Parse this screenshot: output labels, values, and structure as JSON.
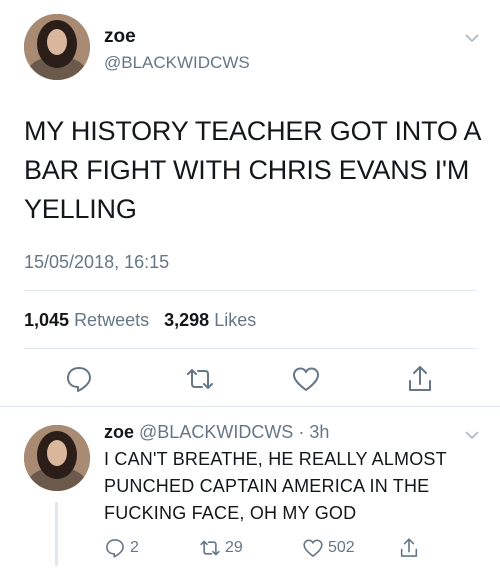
{
  "tweet": {
    "author_name": "zoe",
    "author_handle": "@BLACKWIDCWS",
    "text": "MY HISTORY TEACHER GOT INTO A BAR FIGHT WITH CHRIS EVANS I'M YELLING",
    "timestamp": "15/05/2018, 16:15",
    "retweets_count": "1,045",
    "retweets_label": "Retweets",
    "likes_count": "3,298",
    "likes_label": "Likes",
    "icons": [
      "avatar",
      "chevron-down-icon",
      "reply-icon",
      "retweet-icon",
      "like-icon",
      "share-icon"
    ]
  },
  "reply": {
    "author_name": "zoe",
    "author_handle": "@BLACKWIDCWS",
    "separator": "·",
    "time_ago": "3h",
    "text": "I CAN'T BREATHE, HE REALLY ALMOST PUNCHED CAPTAIN AMERICA IN THE FUCKING FACE, OH MY GOD",
    "reply_count": "2",
    "retweet_count": "29",
    "like_count": "502"
  },
  "colors": {
    "text": "#14171a",
    "secondary": "#657786",
    "divider": "#e1e8ed",
    "icon": "#657786"
  }
}
